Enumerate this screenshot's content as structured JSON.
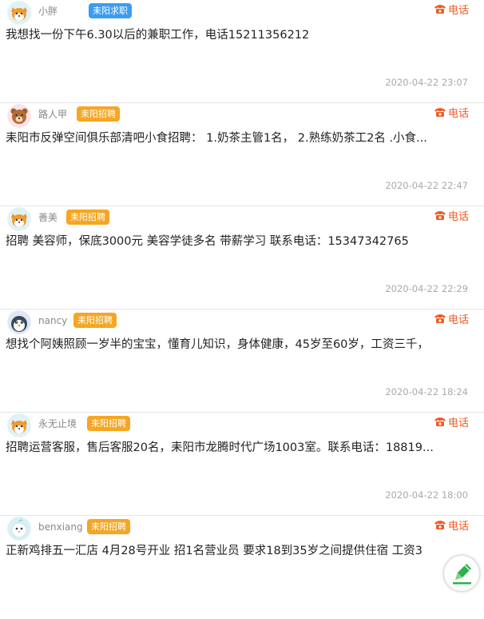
{
  "posts": [
    {
      "name": "小胖",
      "tag": "耒阳求职",
      "tag_color": "#3b9df0",
      "phone_label": "电话",
      "content": "我想找一份下午6.30以后的兼职工作，电话15211356212",
      "time": "2020-04-22 23:07",
      "avatar": "fox-icon"
    },
    {
      "name": "路人甲",
      "tag": "耒阳招聘",
      "tag_color": "#f5a623",
      "phone_label": "电话",
      "content": "耒阳市反弹空间俱乐部清吧小食招聘： 1.奶茶主管1名， 2.熟练奶茶工2名 .小食...",
      "time": "2020-04-22 22:47",
      "avatar": "bear-icon"
    },
    {
      "name": "善美",
      "tag": "耒阳招聘",
      "tag_color": "#f5a623",
      "phone_label": "电话",
      "content": "招聘 美容师，保底3000元 美容学徒多名 带薪学习 联系电话：15347342765",
      "time": "2020-04-22 22:29",
      "avatar": "fox-icon"
    },
    {
      "name": "nancy",
      "tag": "耒阳招聘",
      "tag_color": "#f5a623",
      "phone_label": "电话",
      "content": "想找个阿姨照顾一岁半的宝宝，懂育儿知识，身体健康，45岁至60岁，工资三千，",
      "time": "2020-04-22 18:24",
      "avatar": "penguin-icon"
    },
    {
      "name": "永无止境",
      "tag": "耒阳招聘",
      "tag_color": "#f5a623",
      "phone_label": "电话",
      "content": "招聘运营客服，售后客服20名，耒阳市龙腾时代广场1003室。联系电话：18819...",
      "time": "2020-04-22 18:00",
      "avatar": "fox-icon"
    },
    {
      "name": "benxiang",
      "tag": "耒阳招聘",
      "tag_color": "#f5a623",
      "phone_label": "电话",
      "content": "正新鸡排五一汇店 4月28号开业 招1名营业员 要求18到35岁之间提供住宿 工资3",
      "time": "",
      "avatar": "chick-icon"
    }
  ],
  "accent_color": "#f05a24",
  "fab": {
    "icon": "pencil-icon"
  }
}
